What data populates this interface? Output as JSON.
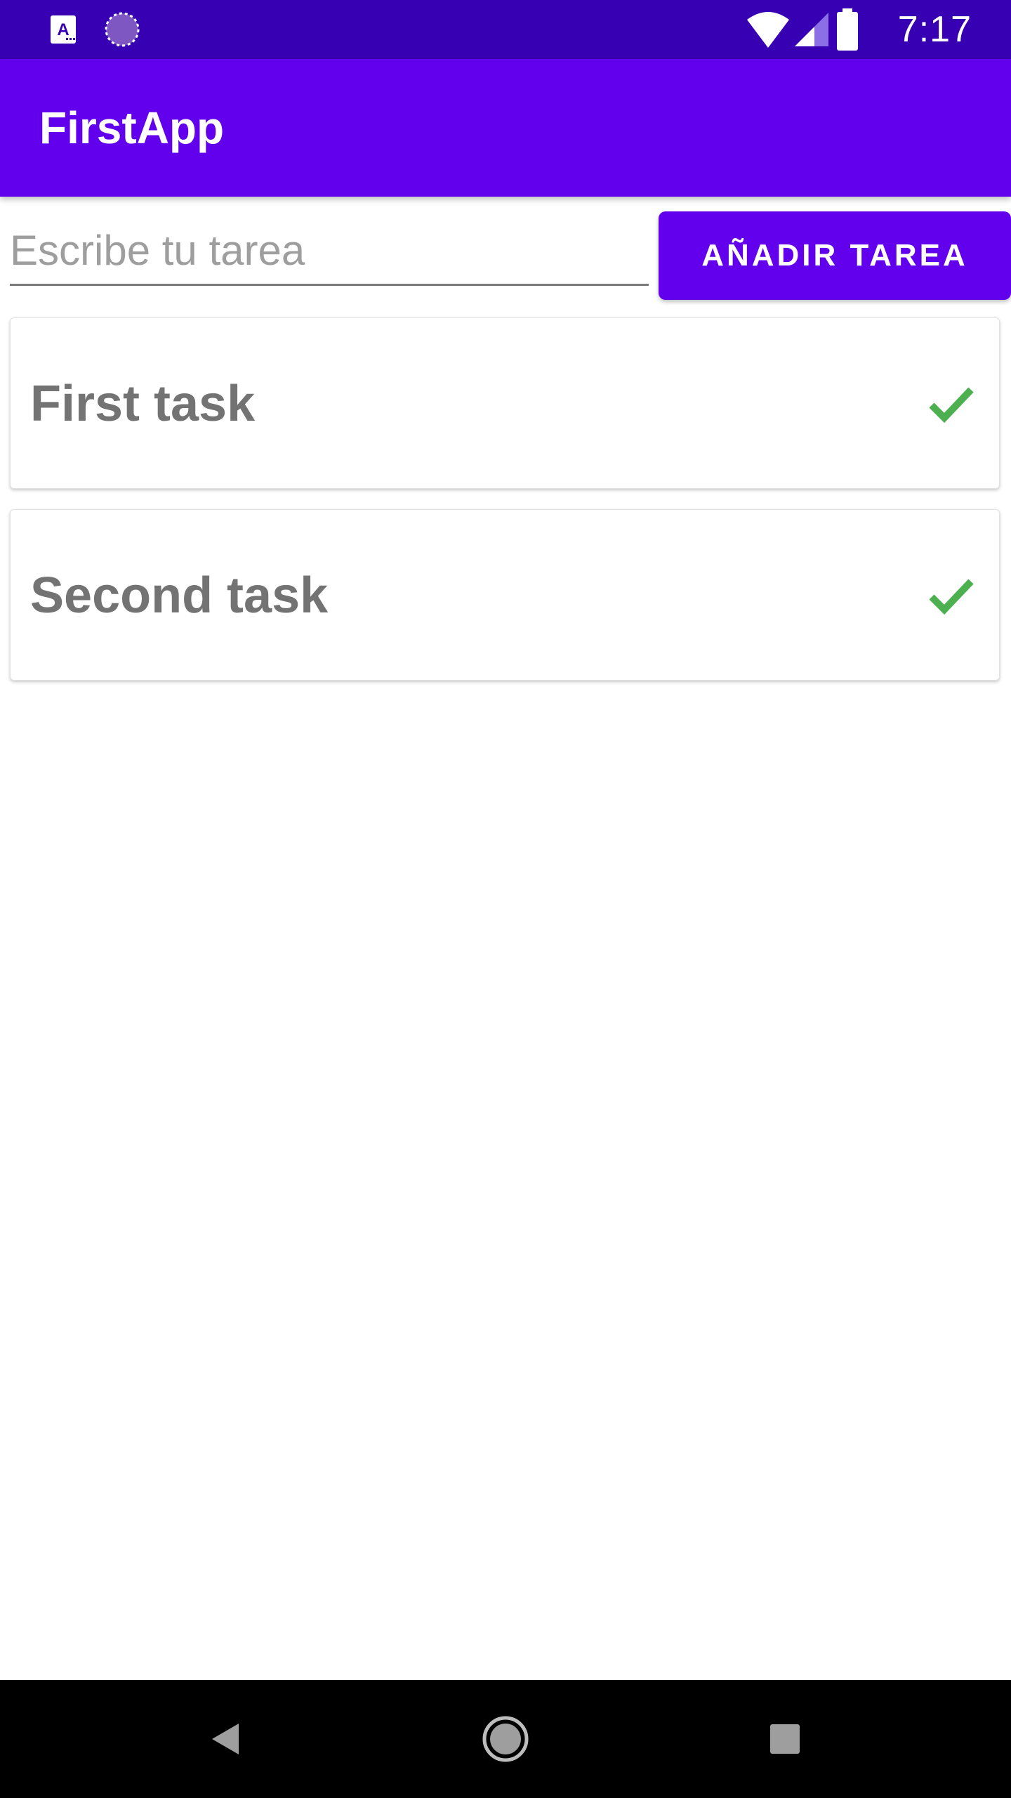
{
  "status_bar": {
    "time": "7:17",
    "left_icons": [
      "keyboard-a-icon",
      "loading-icon"
    ],
    "right_icons": [
      "wifi-icon",
      "signal-icon",
      "battery-icon"
    ],
    "color": "#3700B3"
  },
  "app_bar": {
    "title": "FirstApp",
    "color": "#6200EE"
  },
  "input_row": {
    "placeholder": "Escribe tu tarea",
    "value": "",
    "add_button_label": "AÑADIR TAREA"
  },
  "tasks": [
    {
      "title": "First task",
      "icon": "check-icon",
      "icon_color": "#4CAF50"
    },
    {
      "title": "Second task",
      "icon": "check-icon",
      "icon_color": "#4CAF50"
    }
  ],
  "nav_bar": {
    "buttons": [
      "back-icon",
      "home-icon",
      "recents-icon"
    ]
  }
}
